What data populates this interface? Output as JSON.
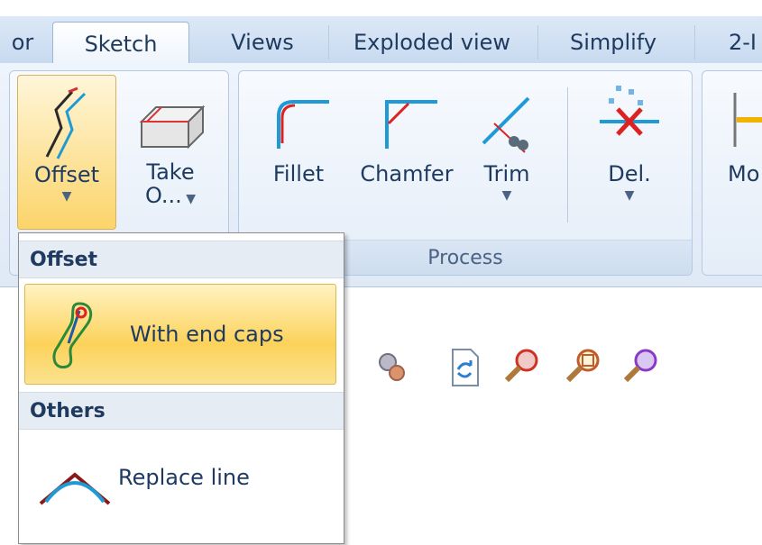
{
  "tabs": [
    {
      "label": "or"
    },
    {
      "label": "Sketch",
      "active": true
    },
    {
      "label": "Views"
    },
    {
      "label": "Exploded view"
    },
    {
      "label": "Simplify"
    },
    {
      "label": "2-I"
    }
  ],
  "ribbon": {
    "offset_label": "Offset",
    "take_label_1": "Take",
    "take_label_2": "O...",
    "fillet_label": "Fillet",
    "chamfer_label": "Chamfer",
    "trim_label": "Trim",
    "del_label": "Del.",
    "mo_label": "Mo",
    "process_group_label": "Process"
  },
  "dropdown": {
    "section1_header": "Offset",
    "item1_label": "With end caps",
    "section2_header": "Others",
    "item2_label": "Replace line"
  },
  "colors": {
    "accent_blue": "#1e3a5f",
    "highlight": "#fcd25a",
    "ribbon_bg": "#dfe9f6"
  }
}
